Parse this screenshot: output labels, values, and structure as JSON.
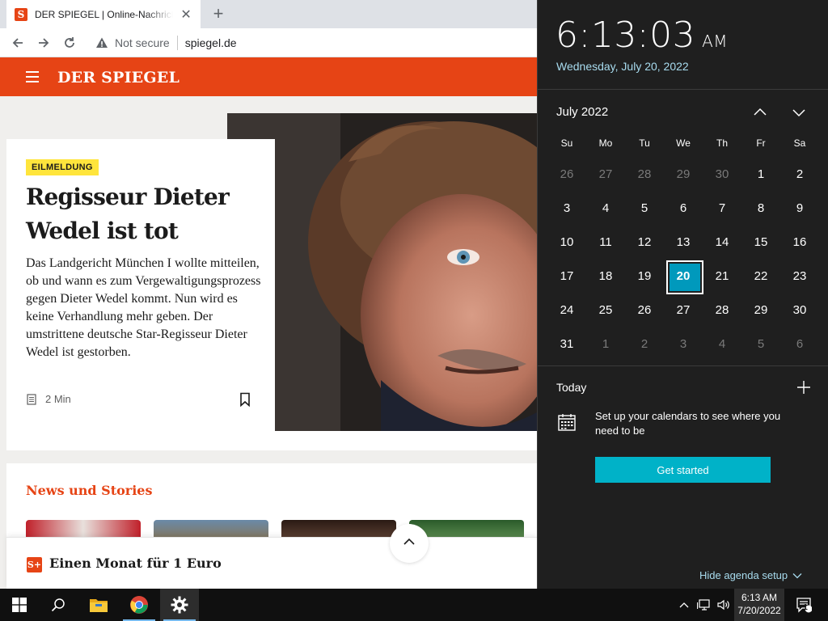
{
  "browser": {
    "tab_title": "DER SPIEGEL | Online-Nachrichten",
    "tab_favicon": "S",
    "tab_close": "✕",
    "new_tab": "+",
    "not_secure": "Not secure",
    "url": "spiegel.de"
  },
  "page": {
    "logo": "DER SPIEGEL",
    "badge": "EILMELDUNG",
    "headline": "Regisseur Dieter Wedel ist tot",
    "teaser": "Das Landgericht München I wollte mitteilen, ob und wann es zum Vergewaltigungsprozess gegen Dieter Wedel kommt. Nun wird es keine Verhandlung mehr geben. Der umstrittene deutsche Star-Regisseur Dieter Wedel ist gestorben.",
    "read_time": "2 Min",
    "section_title": "News und Stories",
    "promo_icon": "S+",
    "promo_text": "Einen Monat für 1 Euro"
  },
  "flyout": {
    "time": "6:13:03",
    "ampm": "AM",
    "date": "Wednesday, July 20, 2022",
    "month": "July 2022",
    "weekdays": [
      "Su",
      "Mo",
      "Tu",
      "We",
      "Th",
      "Fr",
      "Sa"
    ],
    "days": [
      {
        "d": "26",
        "other": true
      },
      {
        "d": "27",
        "other": true
      },
      {
        "d": "28",
        "other": true
      },
      {
        "d": "29",
        "other": true
      },
      {
        "d": "30",
        "other": true
      },
      {
        "d": "1"
      },
      {
        "d": "2"
      },
      {
        "d": "3"
      },
      {
        "d": "4"
      },
      {
        "d": "5"
      },
      {
        "d": "6"
      },
      {
        "d": "7"
      },
      {
        "d": "8"
      },
      {
        "d": "9"
      },
      {
        "d": "10"
      },
      {
        "d": "11"
      },
      {
        "d": "12"
      },
      {
        "d": "13"
      },
      {
        "d": "14"
      },
      {
        "d": "15"
      },
      {
        "d": "16"
      },
      {
        "d": "17"
      },
      {
        "d": "18"
      },
      {
        "d": "19"
      },
      {
        "d": "20",
        "today": true
      },
      {
        "d": "21"
      },
      {
        "d": "22"
      },
      {
        "d": "23"
      },
      {
        "d": "24"
      },
      {
        "d": "25"
      },
      {
        "d": "26"
      },
      {
        "d": "27"
      },
      {
        "d": "28"
      },
      {
        "d": "29"
      },
      {
        "d": "30"
      },
      {
        "d": "31"
      },
      {
        "d": "1",
        "other": true
      },
      {
        "d": "2",
        "other": true
      },
      {
        "d": "3",
        "other": true
      },
      {
        "d": "4",
        "other": true
      },
      {
        "d": "5",
        "other": true
      },
      {
        "d": "6",
        "other": true
      }
    ],
    "today_label": "Today",
    "setup_text": "Set up your calendars to see where you need to be",
    "get_started": "Get started",
    "hide_agenda": "Hide agenda setup"
  },
  "taskbar": {
    "time": "6:13 AM",
    "date": "7/20/2022",
    "notification_count": "1",
    "icons": [
      "windows-start-icon",
      "search-icon",
      "file-explorer-icon",
      "chrome-icon",
      "settings-gear-icon"
    ]
  },
  "colors": {
    "spiegel_red": "#e64415",
    "badge_yellow": "#ffe53c",
    "accent_teal": "#00b2c8",
    "today_blue": "#0099bc",
    "date_text": "#a8dcef"
  }
}
